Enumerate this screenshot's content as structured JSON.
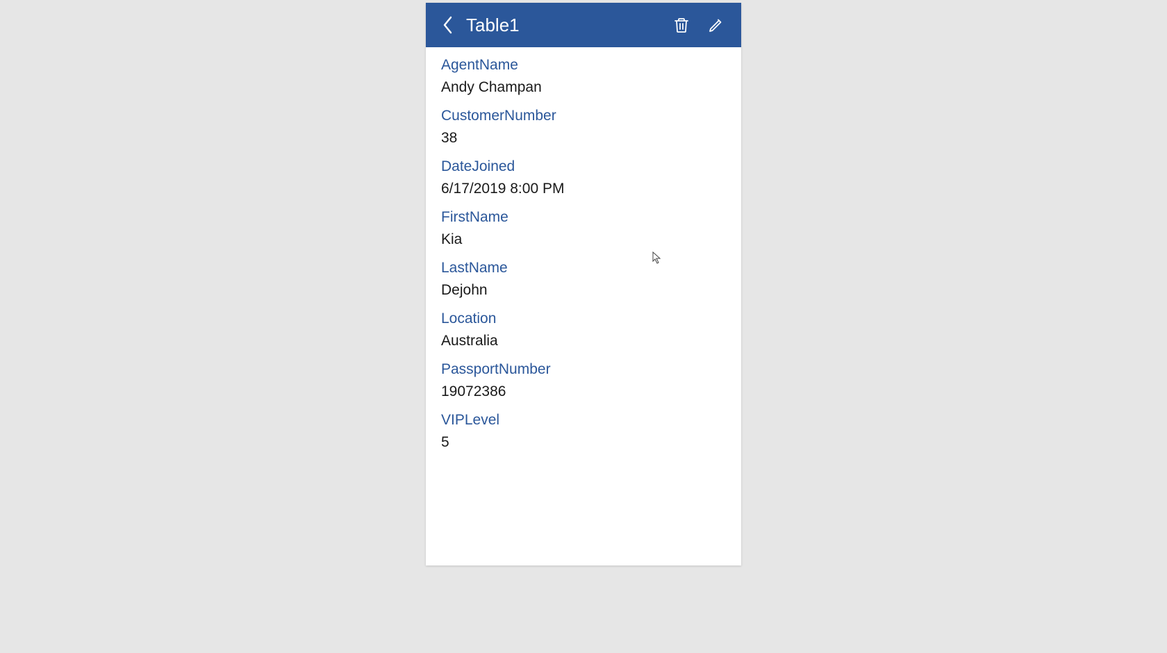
{
  "header": {
    "title": "Table1"
  },
  "fields": [
    {
      "label": "AgentName",
      "value": "Andy Champan"
    },
    {
      "label": "CustomerNumber",
      "value": "38"
    },
    {
      "label": "DateJoined",
      "value": "6/17/2019 8:00 PM"
    },
    {
      "label": "FirstName",
      "value": "Kia"
    },
    {
      "label": "LastName",
      "value": "Dejohn"
    },
    {
      "label": "Location",
      "value": "Australia"
    },
    {
      "label": "PassportNumber",
      "value": "19072386"
    },
    {
      "label": "VIPLevel",
      "value": "5"
    }
  ]
}
